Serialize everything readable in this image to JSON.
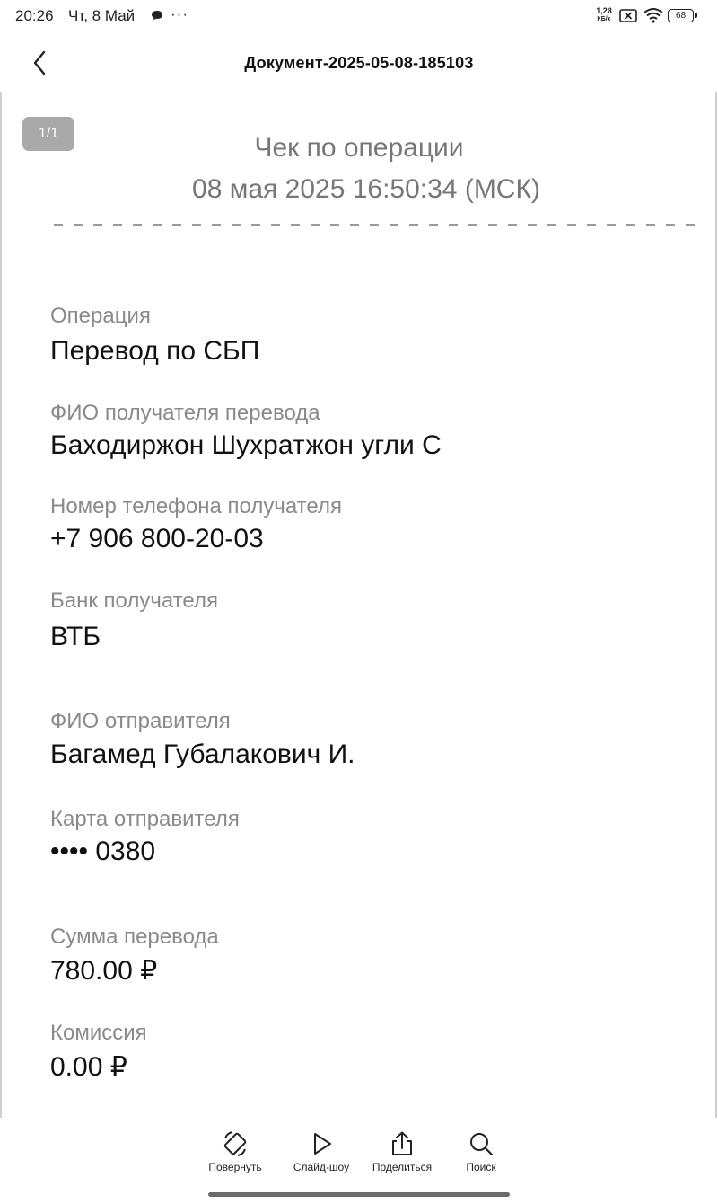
{
  "status_bar": {
    "time": "20:26",
    "date": "Чт, 8 Май",
    "dots": "···",
    "speed_value": "1,28",
    "speed_unit": "КБ/с",
    "battery": "68"
  },
  "header": {
    "title": "Документ-2025-05-08-185103"
  },
  "document": {
    "page_indicator": "1/1",
    "receipt_title": "Чек по операции",
    "receipt_datetime": "08 мая 2025 16:50:34 (МСК)",
    "fields": [
      {
        "label": "Операция",
        "value": "Перевод по СБП"
      },
      {
        "label": "ФИО получателя перевода",
        "value": "Баходиржон Шухратжон угли С"
      },
      {
        "label": "Номер телефона получателя",
        "value": "+7 906 800-20-03"
      },
      {
        "label": "Банк получателя",
        "value": "ВТБ"
      },
      {
        "label": "ФИО отправителя",
        "value": "Багамед Губалакович И."
      },
      {
        "label": "Карта отправителя",
        "value": "•••• 0380"
      },
      {
        "label": "Сумма перевода",
        "value": "780.00  ₽"
      },
      {
        "label": "Комиссия",
        "value": "0.00  ₽"
      }
    ]
  },
  "toolbar": {
    "rotate_label": "Повернуть",
    "slideshow_label": "Слайд-шоу",
    "share_label": "Поделиться",
    "search_label": "Поиск"
  },
  "icons": {
    "back": "chevron-left-icon",
    "rotate": "rotate-icon",
    "slideshow": "play-icon",
    "share": "share-icon",
    "search": "search-icon"
  },
  "colors": {
    "label_gray": "#8a8a8a",
    "title_gray": "#777777",
    "badge_gray": "#a9a9a9"
  }
}
